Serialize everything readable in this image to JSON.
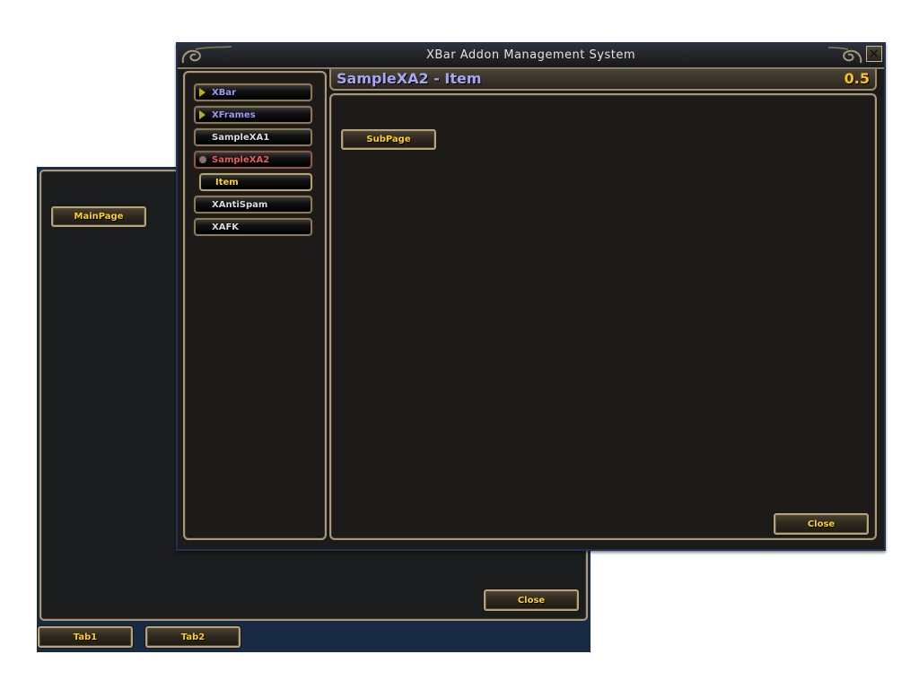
{
  "back_window": {
    "main_button": "MainPage",
    "close_button": "Close",
    "tabs": [
      {
        "label": "Tab1"
      },
      {
        "label": "Tab2"
      }
    ]
  },
  "front_window": {
    "title": "XBar Addon Management System",
    "close_icon": "close-x-icon",
    "sidebar": {
      "items": [
        {
          "label": "XBar",
          "state": "collapsed",
          "icon": "expand-arrow-icon",
          "color": "#9d9bf5"
        },
        {
          "label": "XFrames",
          "state": "collapsed",
          "icon": "expand-arrow-icon",
          "color": "#9d9bf5"
        },
        {
          "label": "SampleXA1",
          "state": "normal",
          "color": "#dcdcdc"
        },
        {
          "label": "SampleXA2",
          "state": "selected",
          "icon": "status-dot-icon",
          "color": "#f25858"
        },
        {
          "label": "Item",
          "state": "sub-selected",
          "color": "#ffd21f"
        },
        {
          "label": "XAntiSpam",
          "state": "normal",
          "color": "#dcdcdc"
        },
        {
          "label": "XAFK",
          "state": "normal",
          "color": "#dcdcdc"
        }
      ]
    },
    "content": {
      "title": "SampleXA2 - Item",
      "version": "0.5",
      "subpage_button": "SubPage",
      "close_button": "Close"
    }
  },
  "colors": {
    "button_text": "#ffd21f",
    "title_accent": "#a6a5f6",
    "version_accent": "#ffc21a",
    "border_gold": "#a8997a",
    "back_bg": "#182a44"
  }
}
